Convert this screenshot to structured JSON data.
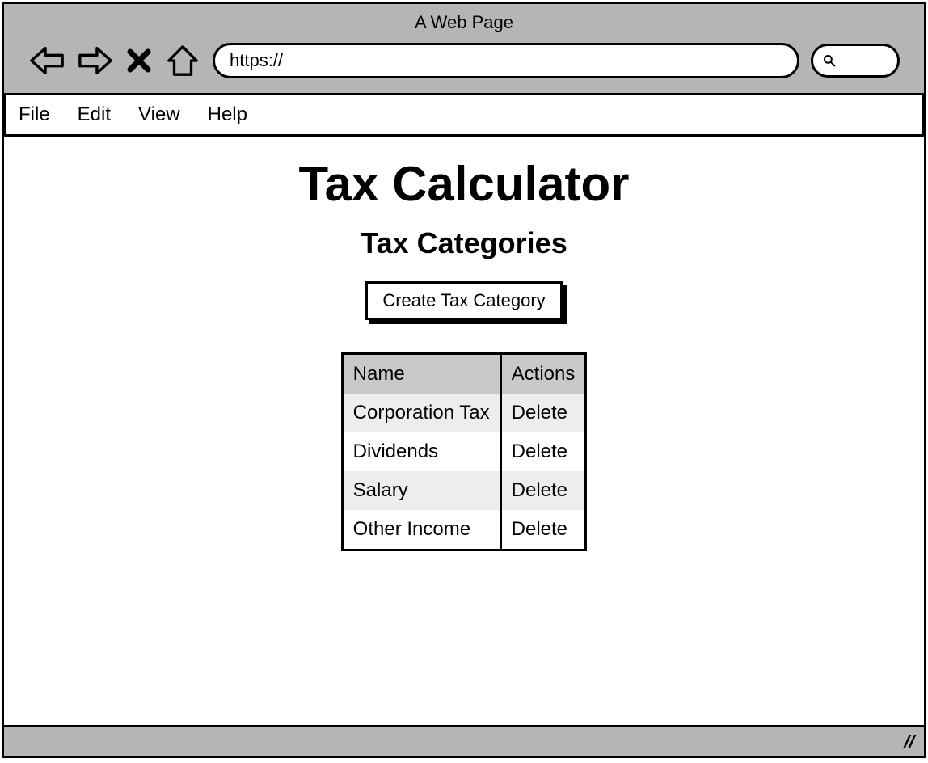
{
  "browser": {
    "title": "A Web Page",
    "url_prefix": "https://"
  },
  "menubar": {
    "items": [
      "File",
      "Edit",
      "View",
      "Help"
    ]
  },
  "page": {
    "app_title": "Tax Calculator",
    "section_title": "Tax Categories",
    "create_button_label": "Create Tax Category"
  },
  "table": {
    "columns": [
      "Name",
      "Actions"
    ],
    "rows": [
      {
        "name": "Corporation Tax",
        "action": "Delete"
      },
      {
        "name": "Dividends",
        "action": "Delete"
      },
      {
        "name": "Salary",
        "action": "Delete"
      },
      {
        "name": "Other Income",
        "action": "Delete"
      }
    ]
  }
}
